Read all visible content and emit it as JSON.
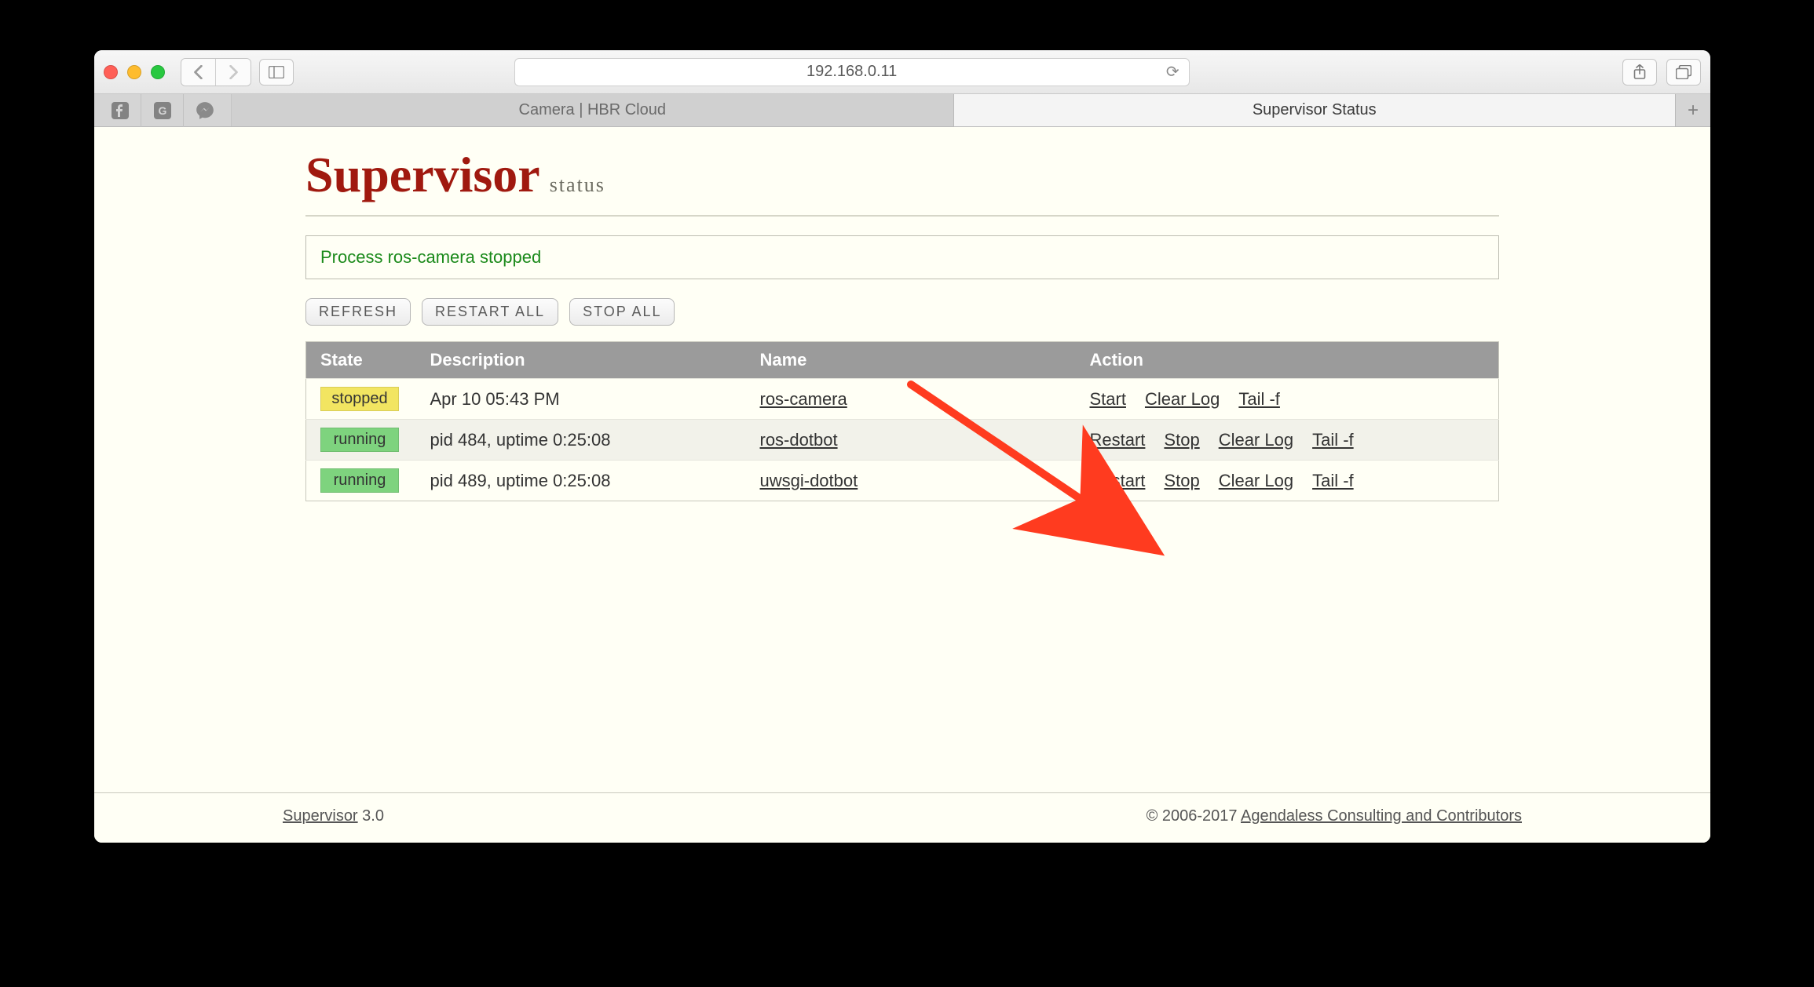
{
  "browser": {
    "address": "192.168.0.11",
    "tabs": [
      {
        "title": "Camera | HBR Cloud",
        "active": false
      },
      {
        "title": "Supervisor Status",
        "active": true
      }
    ]
  },
  "page": {
    "logo_main": "Supervisor",
    "logo_sub": "status",
    "message": "Process ros-camera stopped",
    "buttons": {
      "refresh": "REFRESH",
      "restart_all": "RESTART ALL",
      "stop_all": "STOP ALL"
    },
    "table": {
      "headers": {
        "state": "State",
        "description": "Description",
        "name": "Name",
        "action": "Action"
      },
      "rows": [
        {
          "state": "stopped",
          "state_class": "st-stopped",
          "description": "Apr 10 05:43 PM",
          "name": "ros-camera",
          "actions": [
            "Start",
            "Clear Log",
            "Tail -f"
          ]
        },
        {
          "state": "running",
          "state_class": "st-running",
          "description": "pid 484, uptime 0:25:08",
          "name": "ros-dotbot",
          "actions": [
            "Restart",
            "Stop",
            "Clear Log",
            "Tail -f"
          ]
        },
        {
          "state": "running",
          "state_class": "st-running",
          "description": "pid 489, uptime 0:25:08",
          "name": "uwsgi-dotbot",
          "actions": [
            "Restart",
            "Stop",
            "Clear Log",
            "Tail -f"
          ]
        }
      ]
    },
    "footer": {
      "product": "Supervisor",
      "version": " 3.0",
      "copyright": "© 2006-2017 ",
      "org": "Agendaless Consulting and Contributors"
    }
  },
  "colors": {
    "accent_red": "#a0190f",
    "bg_page": "#fffff5",
    "status_stopped": "#f2e561",
    "status_running": "#7ed37e",
    "arrow": "#ff3b1f"
  }
}
